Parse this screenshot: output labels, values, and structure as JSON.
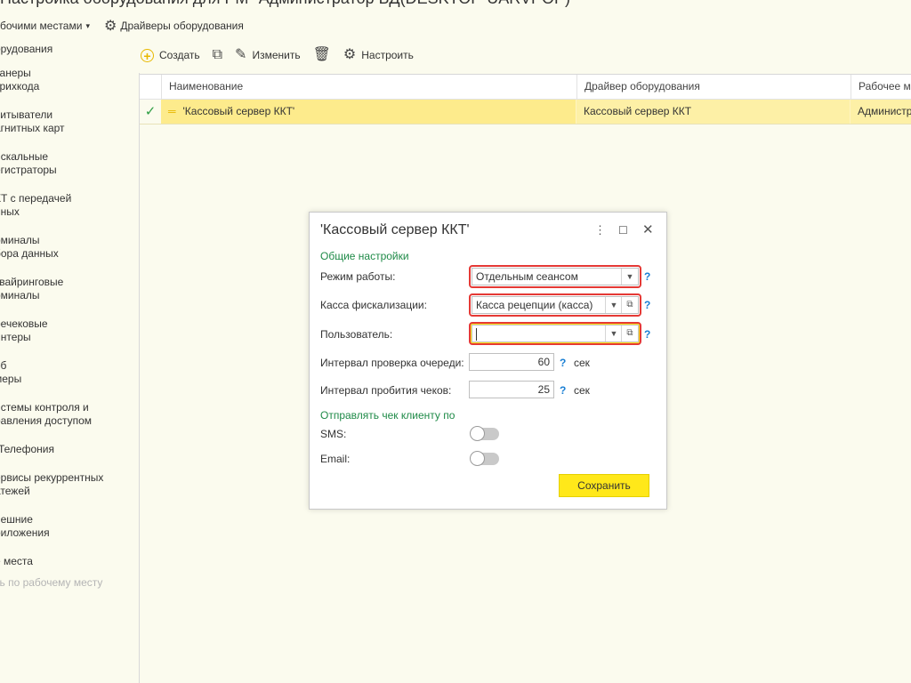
{
  "app": {
    "title": "Настройка оборудования для РМ \"Администратор БД(DESKTOP-UARVPOP)\""
  },
  "top_menu": {
    "workplaces_label": "бочими местами",
    "workplaces_arrow": "▾",
    "drivers_label": "Драйверы оборудования"
  },
  "sidebar": {
    "items": [
      {
        "label": "орудования"
      },
      {
        "label": "канеры\nтрихкода"
      },
      {
        "label": "читыватели\nагнитных карт"
      },
      {
        "label": "искальные\nегистраторы"
      },
      {
        "label": "КТ с передачей\nнных"
      },
      {
        "label": "рминалы\nбора данных"
      },
      {
        "label": "квайринговые\nрминалы"
      },
      {
        "label": "речековые\nинтеры"
      },
      {
        "label": "еб\nмеры"
      },
      {
        "label": "истемы контроля и\nравления доступом"
      },
      {
        "label": "-Телефония"
      },
      {
        "label": "ервисы рекуррентных\nатежей"
      },
      {
        "label": "нешние\nриложения"
      },
      {
        "label": "е места"
      },
      {
        "label": "ть по рабочему месту"
      }
    ]
  },
  "toolbar": {
    "create_label": "Создать",
    "edit_label": "Изменить",
    "configure_label": "Настроить"
  },
  "table": {
    "columns": [
      "Наименование",
      "Драйвер оборудования",
      "Рабочее место"
    ],
    "rows": [
      {
        "checked": "✓",
        "name": "'Кассовый сервер ККТ'",
        "driver": "Кассовый сервер ККТ",
        "workplace": "Администратор БД"
      }
    ]
  },
  "dialog": {
    "title": "'Кассовый сервер ККТ'",
    "section_general": "Общие настройки",
    "mode_label": "Режим работы:",
    "mode_value": "Отдельным сеансом",
    "fiscal_label": "Касса фискализации:",
    "fiscal_value": "Касса рецепции (касса)",
    "user_label": "Пользователь:",
    "user_value": "",
    "queue_label": "Интервал проверка очереди:",
    "queue_value": "60",
    "print_label": "Интервал пробития чеков:",
    "print_value": "25",
    "unit_sec": "сек",
    "section_send": "Отправлять чек клиенту по",
    "sms_label": "SMS:",
    "email_label": "Email:",
    "save_label": "Сохранить",
    "help_mark": "?"
  },
  "colors": {
    "accent_yellow": "#ffe81a",
    "section_green": "#1e8a47",
    "highlight_red": "#e53935",
    "selected_row": "#fdf0a6",
    "help_blue": "#1a7fd4"
  }
}
